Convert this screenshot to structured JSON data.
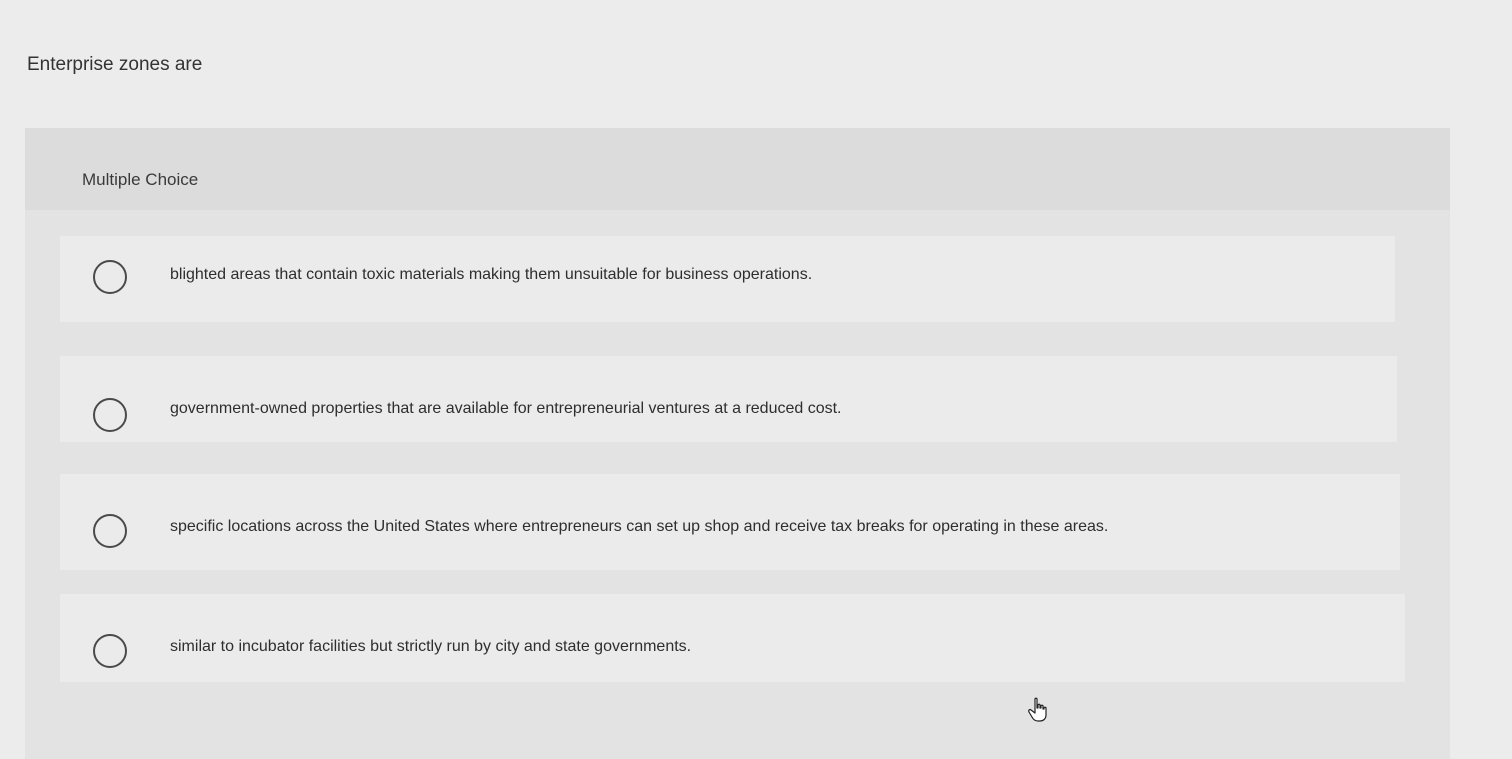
{
  "question": {
    "prompt": "Enterprise zones are"
  },
  "multiple_choice": {
    "header": "Multiple Choice",
    "options": [
      {
        "label": "blighted areas that contain toxic materials making them unsuitable for business operations.",
        "selected": false
      },
      {
        "label": "government-owned properties that are available for entrepreneurial ventures at a reduced cost.",
        "selected": false
      },
      {
        "label": "specific locations across the United States where entrepreneurs can set up shop and receive tax breaks for operating in these areas.",
        "selected": false
      },
      {
        "label": "similar to incubator facilities but strictly run by city and state governments.",
        "selected": false
      }
    ]
  },
  "cursor": {
    "icon": "hand-pointer-icon"
  }
}
